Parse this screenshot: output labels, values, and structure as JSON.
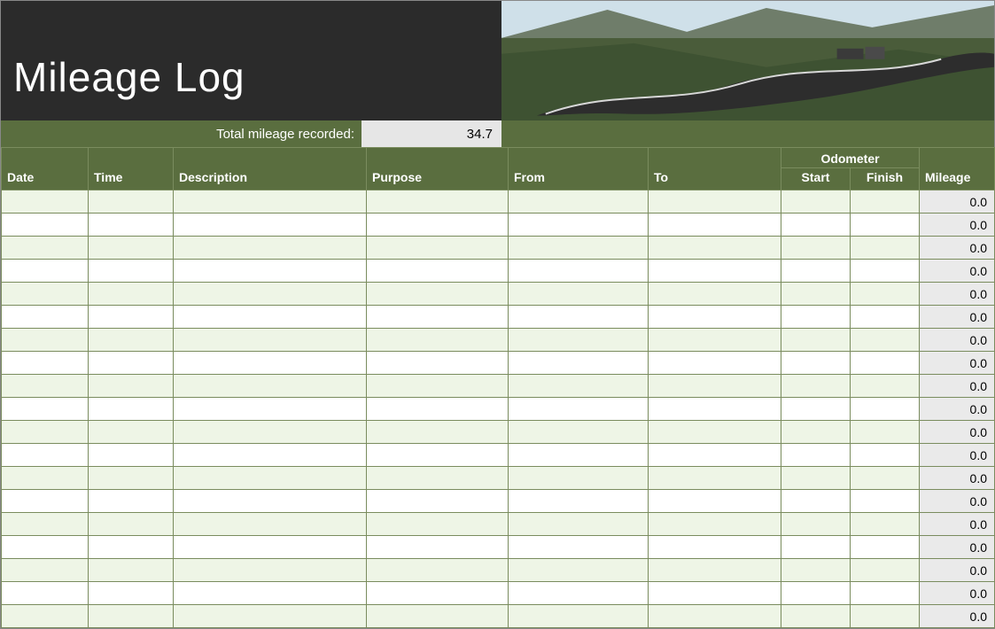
{
  "title": "Mileage Log",
  "summary": {
    "label": "Total mileage recorded:",
    "value": "34.7"
  },
  "headers": {
    "date": "Date",
    "time": "Time",
    "description": "Description",
    "purpose": "Purpose",
    "from": "From",
    "to": "To",
    "odometer": "Odometer",
    "start": "Start",
    "finish": "Finish",
    "mileage": "Mileage"
  },
  "rows": [
    {
      "date": "",
      "time": "",
      "description": "",
      "purpose": "",
      "from": "",
      "to": "",
      "start": "",
      "finish": "",
      "mileage": "0.0"
    },
    {
      "date": "",
      "time": "",
      "description": "",
      "purpose": "",
      "from": "",
      "to": "",
      "start": "",
      "finish": "",
      "mileage": "0.0"
    },
    {
      "date": "",
      "time": "",
      "description": "",
      "purpose": "",
      "from": "",
      "to": "",
      "start": "",
      "finish": "",
      "mileage": "0.0"
    },
    {
      "date": "",
      "time": "",
      "description": "",
      "purpose": "",
      "from": "",
      "to": "",
      "start": "",
      "finish": "",
      "mileage": "0.0"
    },
    {
      "date": "",
      "time": "",
      "description": "",
      "purpose": "",
      "from": "",
      "to": "",
      "start": "",
      "finish": "",
      "mileage": "0.0"
    },
    {
      "date": "",
      "time": "",
      "description": "",
      "purpose": "",
      "from": "",
      "to": "",
      "start": "",
      "finish": "",
      "mileage": "0.0"
    },
    {
      "date": "",
      "time": "",
      "description": "",
      "purpose": "",
      "from": "",
      "to": "",
      "start": "",
      "finish": "",
      "mileage": "0.0"
    },
    {
      "date": "",
      "time": "",
      "description": "",
      "purpose": "",
      "from": "",
      "to": "",
      "start": "",
      "finish": "",
      "mileage": "0.0"
    },
    {
      "date": "",
      "time": "",
      "description": "",
      "purpose": "",
      "from": "",
      "to": "",
      "start": "",
      "finish": "",
      "mileage": "0.0"
    },
    {
      "date": "",
      "time": "",
      "description": "",
      "purpose": "",
      "from": "",
      "to": "",
      "start": "",
      "finish": "",
      "mileage": "0.0"
    },
    {
      "date": "",
      "time": "",
      "description": "",
      "purpose": "",
      "from": "",
      "to": "",
      "start": "",
      "finish": "",
      "mileage": "0.0"
    },
    {
      "date": "",
      "time": "",
      "description": "",
      "purpose": "",
      "from": "",
      "to": "",
      "start": "",
      "finish": "",
      "mileage": "0.0"
    },
    {
      "date": "",
      "time": "",
      "description": "",
      "purpose": "",
      "from": "",
      "to": "",
      "start": "",
      "finish": "",
      "mileage": "0.0"
    },
    {
      "date": "",
      "time": "",
      "description": "",
      "purpose": "",
      "from": "",
      "to": "",
      "start": "",
      "finish": "",
      "mileage": "0.0"
    },
    {
      "date": "",
      "time": "",
      "description": "",
      "purpose": "",
      "from": "",
      "to": "",
      "start": "",
      "finish": "",
      "mileage": "0.0"
    },
    {
      "date": "",
      "time": "",
      "description": "",
      "purpose": "",
      "from": "",
      "to": "",
      "start": "",
      "finish": "",
      "mileage": "0.0"
    },
    {
      "date": "",
      "time": "",
      "description": "",
      "purpose": "",
      "from": "",
      "to": "",
      "start": "",
      "finish": "",
      "mileage": "0.0"
    },
    {
      "date": "",
      "time": "",
      "description": "",
      "purpose": "",
      "from": "",
      "to": "",
      "start": "",
      "finish": "",
      "mileage": "0.0"
    },
    {
      "date": "",
      "time": "",
      "description": "",
      "purpose": "",
      "from": "",
      "to": "",
      "start": "",
      "finish": "",
      "mileage": "0.0"
    }
  ]
}
